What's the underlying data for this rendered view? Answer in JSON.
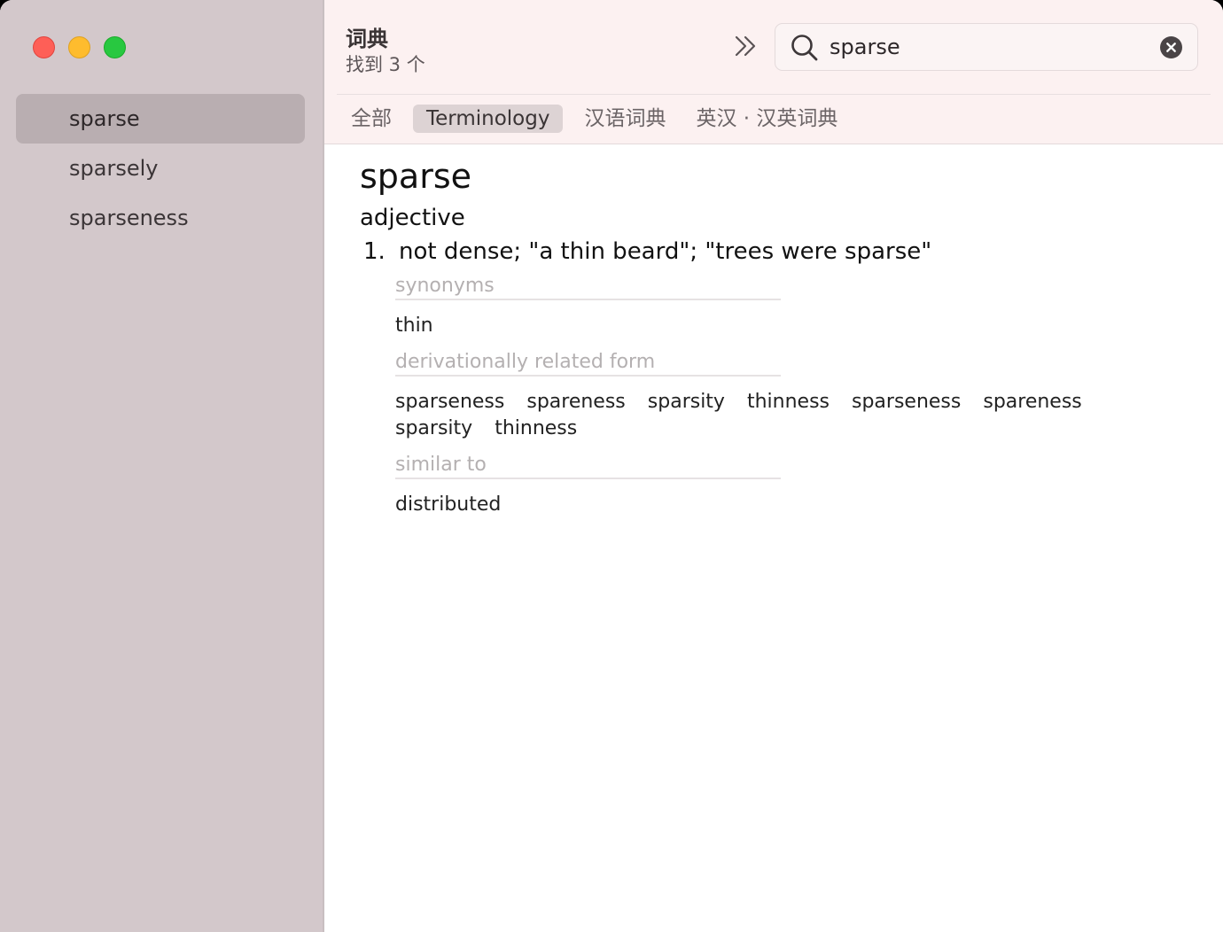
{
  "header": {
    "title": "词典",
    "subtitle": "找到 3 个",
    "forward_icon": "double-chevron-right-icon"
  },
  "search": {
    "value": "sparse",
    "icon": "magnifying-glass-icon",
    "clear_icon": "clear-circle-x-icon"
  },
  "sidebar": {
    "items": [
      {
        "label": "sparse",
        "selected": true
      },
      {
        "label": "sparsely",
        "selected": false
      },
      {
        "label": "sparseness",
        "selected": false
      }
    ]
  },
  "tabs": [
    {
      "label": "全部",
      "active": false
    },
    {
      "label": "Terminology",
      "active": true
    },
    {
      "label": "汉语词典",
      "active": false
    },
    {
      "label": "英汉 · 汉英词典",
      "active": false
    }
  ],
  "entry": {
    "word": "sparse",
    "pos": "adjective",
    "definition_number": "1.",
    "definition": "not dense; \"a thin beard\"; \"trees were sparse\"",
    "sections": [
      {
        "label": "synonyms",
        "items": [
          "thin"
        ]
      },
      {
        "label": "derivationally related form",
        "items": [
          "sparseness",
          "spareness",
          "sparsity",
          "thinness",
          "sparseness",
          "spareness",
          "sparsity",
          "thinness"
        ]
      },
      {
        "label": "similar to",
        "items": [
          "distributed"
        ]
      }
    ]
  },
  "colors": {
    "sidebar_bg": "#d3c8cb",
    "header_bg": "#fcf1f1",
    "selected_item_bg": "#b9aeb1",
    "active_tab_bg": "#ddd3d4"
  }
}
